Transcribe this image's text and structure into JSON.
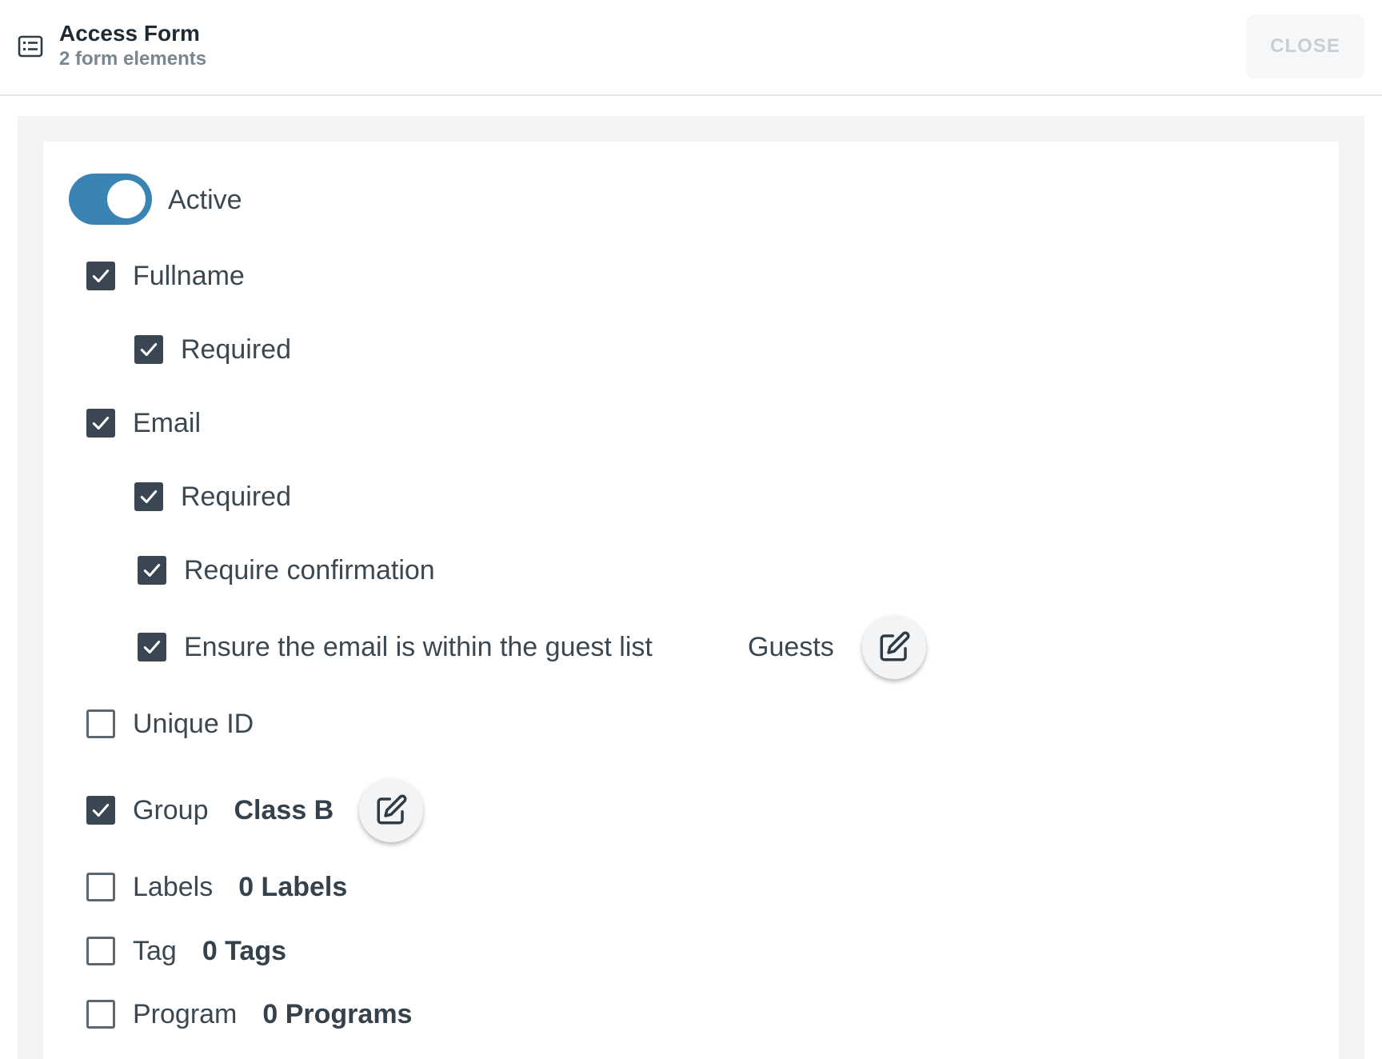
{
  "header": {
    "icon": "form-list-icon",
    "title": "Access Form",
    "subtitle": "2 form elements",
    "close_label": "CLOSE"
  },
  "toggle": {
    "label": "Active",
    "on": true,
    "color": "#3a84b4"
  },
  "fields": {
    "fullname": {
      "label": "Fullname",
      "checked": true,
      "required": {
        "label": "Required",
        "checked": true
      }
    },
    "email": {
      "label": "Email",
      "checked": true,
      "required": {
        "label": "Required",
        "checked": true
      },
      "confirmation": {
        "label": "Require confirmation",
        "checked": true
      },
      "guest_list": {
        "label": "Ensure the email is within the guest list",
        "checked": true,
        "list_name": "Guests",
        "edit_icon": "edit-icon"
      }
    },
    "unique_id": {
      "label": "Unique ID",
      "checked": false
    },
    "group": {
      "label": "Group",
      "checked": true,
      "value": "Class B",
      "edit_icon": "edit-icon"
    },
    "labels": {
      "label": "Labels",
      "checked": false,
      "value": "0 Labels"
    },
    "tag": {
      "label": "Tag",
      "checked": false,
      "value": "0 Tags"
    },
    "program": {
      "label": "Program",
      "checked": false,
      "value": "0 Programs"
    }
  }
}
